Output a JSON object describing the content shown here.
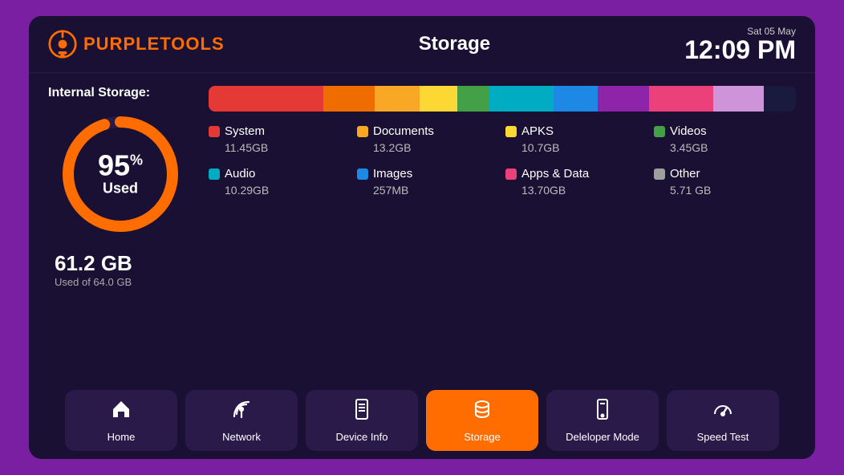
{
  "header": {
    "logo_purple": "PURPLE",
    "logo_tools": "TOOLS",
    "title": "Storage",
    "date_line1": "Sat",
    "date_line2": "05 May",
    "time": "12:09 PM"
  },
  "storage": {
    "section_label": "Internal Storage:",
    "percent": "95",
    "used_label": "Used",
    "total_used": "61.2 GB",
    "used_of": "Used of 64.0 GB",
    "color_bar": [
      {
        "color": "#E53935",
        "flex": 18
      },
      {
        "color": "#EF6C00",
        "flex": 8
      },
      {
        "color": "#F9A825",
        "flex": 7
      },
      {
        "color": "#FDD835",
        "flex": 6
      },
      {
        "color": "#43A047",
        "flex": 5
      },
      {
        "color": "#00ACC1",
        "flex": 10
      },
      {
        "color": "#1E88E5",
        "flex": 7
      },
      {
        "color": "#8E24AA",
        "flex": 8
      },
      {
        "color": "#EC407A",
        "flex": 10
      },
      {
        "color": "#CE93D8",
        "flex": 8
      },
      {
        "color": "#1a1a3e",
        "flex": 5
      }
    ],
    "items": [
      {
        "name": "System",
        "size": "11.45GB",
        "color": "#E53935"
      },
      {
        "name": "Documents",
        "size": "13.2GB",
        "color": "#F9A825"
      },
      {
        "name": "APKS",
        "size": "10.7GB",
        "color": "#FDD835"
      },
      {
        "name": "Videos",
        "size": "3.45GB",
        "color": "#43A047"
      },
      {
        "name": "Audio",
        "size": "10.29GB",
        "color": "#00ACC1"
      },
      {
        "name": "Images",
        "size": "257MB",
        "color": "#1E88E5"
      },
      {
        "name": "Apps & Data",
        "size": "13.70GB",
        "color": "#EC407A"
      },
      {
        "name": "Other",
        "size": "5.71 GB",
        "color": "#9E9E9E"
      }
    ]
  },
  "nav": {
    "items": [
      {
        "label": "Home",
        "icon": "🏠",
        "active": false,
        "name": "home"
      },
      {
        "label": "Network",
        "icon": "📡",
        "active": false,
        "name": "network"
      },
      {
        "label": "Device Info",
        "icon": "📋",
        "active": false,
        "name": "device-info"
      },
      {
        "label": "Storage",
        "icon": "☁",
        "active": true,
        "name": "storage"
      },
      {
        "label": "Deleloper Mode",
        "icon": "📱",
        "active": false,
        "name": "developer-mode"
      },
      {
        "label": "Speed Test",
        "icon": "⏱",
        "active": false,
        "name": "speed-test"
      }
    ]
  }
}
